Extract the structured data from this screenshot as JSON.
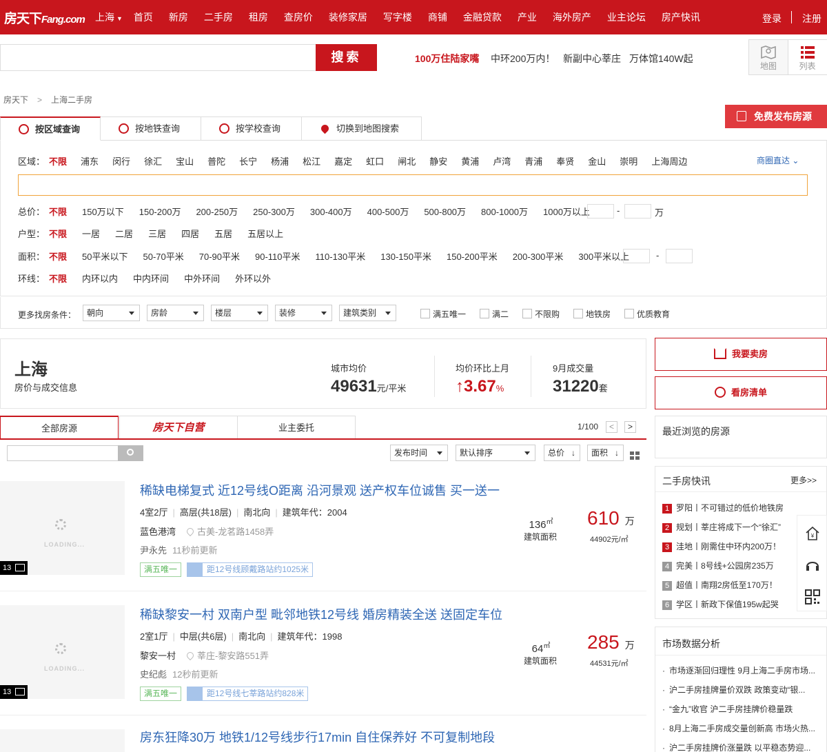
{
  "header": {
    "logo": "房天下",
    "logo_sub": "Fang.com",
    "city": "上海",
    "nav": [
      "首页",
      "新房",
      "二手房",
      "租房",
      "查房价",
      "装修家居",
      "写字楼",
      "商铺",
      "金融贷款",
      "产业",
      "海外房产",
      "业主论坛",
      "房产快讯"
    ],
    "login": "登录",
    "register": "注册"
  },
  "search": {
    "placeholder": "",
    "button": "搜索",
    "promos": [
      "100万住陆家嘴",
      "中环200万内！",
      "新副中心莘庄",
      "万体馆140W起"
    ],
    "map_label": "地图",
    "list_label": "列表"
  },
  "breadcrumb": [
    "房天下",
    "上海二手房"
  ],
  "publish_button": "免费发布房源",
  "query_tabs": [
    "按区域查询",
    "按地铁查询",
    "按学校查询",
    "切换到地图搜索"
  ],
  "filters": {
    "district_label": "区域：",
    "districts": [
      "不限",
      "浦东",
      "闵行",
      "徐汇",
      "宝山",
      "普陀",
      "长宁",
      "杨浦",
      "松江",
      "嘉定",
      "虹口",
      "闸北",
      "静安",
      "黄浦",
      "卢湾",
      "青浦",
      "奉贤",
      "金山",
      "崇明",
      "上海周边"
    ],
    "biz_link": "商圈直达",
    "price_label": "总价：",
    "prices": [
      "不限",
      "150万以下",
      "150-200万",
      "200-250万",
      "250-300万",
      "300-400万",
      "400-500万",
      "500-800万",
      "800-1000万",
      "1000万以上"
    ],
    "price_unit": "万",
    "layout_label": "户型：",
    "layouts": [
      "不限",
      "一居",
      "二居",
      "三居",
      "四居",
      "五居",
      "五居以上"
    ],
    "area_label": "面积：",
    "areas": [
      "不限",
      "50平米以下",
      "50-70平米",
      "70-90平米",
      "90-110平米",
      "110-130平米",
      "130-150平米",
      "150-200平米",
      "200-300平米",
      "300平米以上"
    ],
    "ring_label": "环线：",
    "rings": [
      "不限",
      "内环以内",
      "中内环间",
      "中外环间",
      "外环以外"
    ],
    "dash": "-",
    "more_label": "更多找房条件：",
    "selects": [
      "朝向",
      "房龄",
      "楼层",
      "装修",
      "建筑类别"
    ],
    "checkboxes": [
      "满五唯一",
      "满二",
      "不限购",
      "地铁房",
      "优质教育"
    ]
  },
  "market": {
    "city": "上海",
    "subtitle": "房价与成交信息",
    "avg_label": "城市均价",
    "avg_value": "49631",
    "avg_unit": "元/平米",
    "mom_label": "均价环比上月",
    "mom_value": "↑3.67",
    "mom_unit": "%",
    "deal_label": "9月成交量",
    "deal_value": "31220",
    "deal_unit": "套"
  },
  "side": {
    "sell_button": "我要卖房",
    "list_button": "看房清单",
    "recent_title": "最近浏览的房源",
    "news_title": "二手房快讯",
    "news_more": "更多>>",
    "news": [
      {
        "num": "1",
        "text": "罗阳丨不可错过的低价地铁房"
      },
      {
        "num": "2",
        "text": "规划丨莘庄将成下一个“徐汇”"
      },
      {
        "num": "3",
        "text": "洼地丨刚需住中环内200万！"
      },
      {
        "num": "4",
        "text": "完美丨8号线+公园房235万"
      },
      {
        "num": "5",
        "text": "超值丨南翔2房低至170万！"
      },
      {
        "num": "6",
        "text": "学区丨新政下保值195w起哭"
      }
    ],
    "market_title": "市场数据分析",
    "market_items": [
      "市场逐渐回归理性 9月上海二手房市场...",
      "沪二手房挂牌量价双跌 政策变动“银...",
      "“金九”收官 沪二手房挂牌价稳量跌",
      "8月上海二手房成交量创新高 市场火热...",
      "沪二手房挂牌价涨量跌 以平稳态势迎..."
    ]
  },
  "list": {
    "tabs": [
      "全部房源",
      "房天下自营",
      "业主委托"
    ],
    "pager": "1/100",
    "prev": "<",
    "next": ">",
    "sorts": [
      "发布时间",
      "默认排序",
      "总价",
      "面积"
    ],
    "items": [
      {
        "title": "稀缺电梯复式 近12号线O距离 沿河景观 送产权车位诚售 买一送一",
        "layout": "4室2厅",
        "floor": "高层(共18层)",
        "orient": "南北向",
        "year": "建筑年代：2004",
        "community": "蓝色港湾",
        "address": "古美-龙茗路1458弄",
        "agent": "尹永先",
        "updated": "11秒前更新",
        "tag": "满五唯一",
        "metro": "距12号线顾戴路站约1025米",
        "photos": "13",
        "loading": "LOADING...",
        "area": "136",
        "area_unit": "㎡",
        "area_label": "建筑面积",
        "price": "610",
        "price_unit": "万",
        "unit_price": "44902元/㎡"
      },
      {
        "title": "稀缺黎安一村 双南户型 毗邻地铁12号线 婚房精装全送 送固定车位",
        "layout": "2室1厅",
        "floor": "中层(共6层)",
        "orient": "南北向",
        "year": "建筑年代：1998",
        "community": "黎安一村",
        "address": "莘庄-黎安路551弄",
        "agent": "史纪彪",
        "updated": "12秒前更新",
        "tag": "满五唯一",
        "metro": "距12号线七莘路站约828米",
        "photos": "13",
        "loading": "LOADING...",
        "area": "64",
        "area_unit": "㎡",
        "area_label": "建筑面积",
        "price": "285",
        "price_unit": "万",
        "unit_price": "44531元/㎡"
      },
      {
        "title": "房东狂降30万 地铁1/12号线步行17min 自住保养好 不可复制地段"
      }
    ]
  },
  "colors": {
    "brand": "#c8161d",
    "link": "#2f67b4",
    "tag_green": "#5cb85c",
    "metro_blue": "#7aa3d9"
  }
}
